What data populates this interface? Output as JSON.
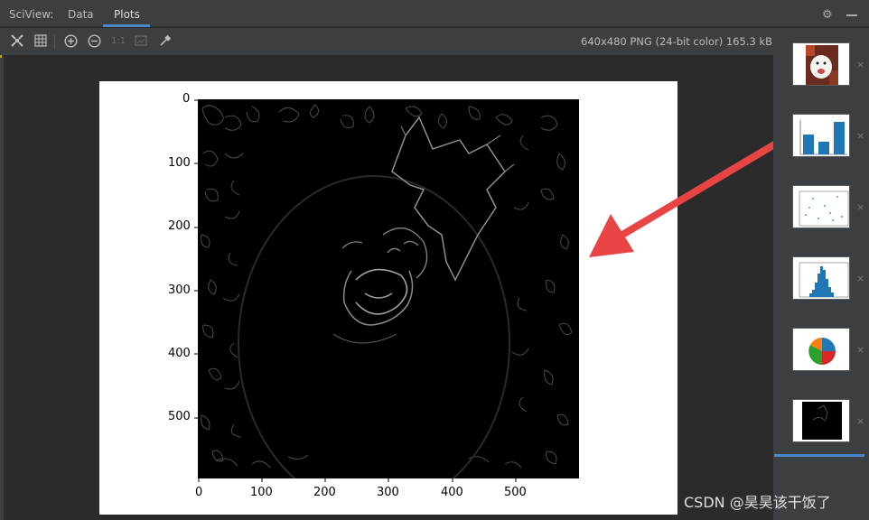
{
  "tabs": {
    "prefix": "SciView:",
    "data_label": "Data",
    "plots_label": "Plots"
  },
  "toolbar": {
    "icons": [
      "fit-icon",
      "grid-icon",
      "zoom-in-icon",
      "zoom-out-icon",
      "actual-size-icon",
      "fit-window-icon",
      "color-picker-icon"
    ],
    "actual_size_label": "1:1",
    "image_info": "640x480 PNG (24-bit color) 165.3 kB"
  },
  "plot": {
    "y_ticks": [
      "0",
      "100",
      "200",
      "300",
      "400",
      "500"
    ],
    "x_ticks": [
      "0",
      "100",
      "200",
      "300",
      "400",
      "500"
    ]
  },
  "thumbnails": [
    {
      "name": "dog-photo-thumb",
      "kind": "photo"
    },
    {
      "name": "bar-chart-thumb",
      "kind": "bar"
    },
    {
      "name": "scatter-thumb",
      "kind": "scatter"
    },
    {
      "name": "histogram-thumb",
      "kind": "hist"
    },
    {
      "name": "pie-thumb",
      "kind": "pie"
    },
    {
      "name": "edge-image-thumb",
      "kind": "edge",
      "selected": true
    }
  ],
  "watermark": "CSDN @昊昊该干饭了",
  "colors": {
    "accent": "#4a88c7",
    "arrow": "#e84444",
    "panel": "#3c3f41",
    "background": "#2b2b2b"
  }
}
